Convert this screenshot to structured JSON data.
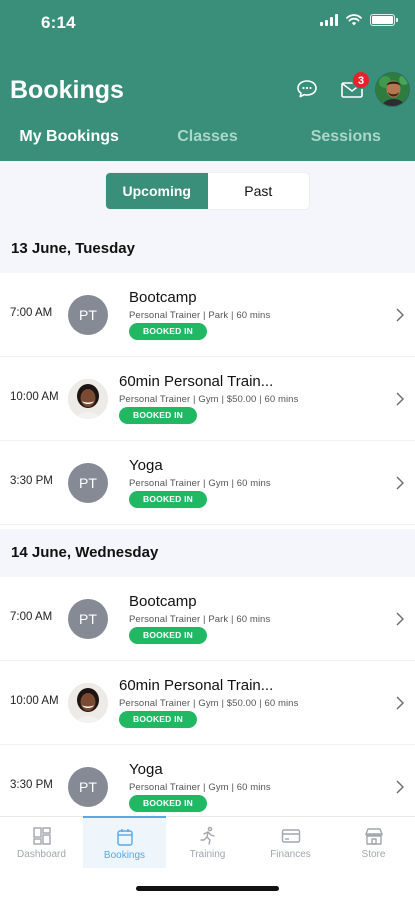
{
  "status_bar": {
    "time": "6:14"
  },
  "header": {
    "title": "Bookings",
    "mail_badge": "3",
    "tabs": [
      {
        "label": "My Bookings",
        "active": true
      },
      {
        "label": "Classes",
        "active": false
      },
      {
        "label": "Sessions",
        "active": false
      }
    ]
  },
  "segmented": {
    "upcoming": "Upcoming",
    "past": "Past",
    "selected": "Upcoming"
  },
  "sections": [
    {
      "date": "13 June, Tuesday",
      "items": [
        {
          "time": "7:00 AM",
          "avatar": "PT",
          "title": "Bootcamp",
          "subtitle": "Personal Trainer | Park | 60 mins",
          "status": "BOOKED IN"
        },
        {
          "time": "10:00 AM",
          "avatar": "photo",
          "title": "60min Personal Train...",
          "subtitle": "Personal Trainer | Gym | $50.00 | 60 mins",
          "status": "BOOKED IN"
        },
        {
          "time": "3:30 PM",
          "avatar": "PT",
          "title": "Yoga",
          "subtitle": "Personal Trainer | Gym | 60 mins",
          "status": "BOOKED IN"
        }
      ]
    },
    {
      "date": "14 June, Wednesday",
      "items": [
        {
          "time": "7:00 AM",
          "avatar": "PT",
          "title": "Bootcamp",
          "subtitle": "Personal Trainer | Park | 60 mins",
          "status": "BOOKED IN"
        },
        {
          "time": "10:00 AM",
          "avatar": "photo",
          "title": "60min Personal Train...",
          "subtitle": "Personal Trainer | Gym | $50.00 | 60 mins",
          "status": "BOOKED IN"
        },
        {
          "time": "3:30 PM",
          "avatar": "PT",
          "title": "Yoga",
          "subtitle": "Personal Trainer | Gym | 60 mins",
          "status": "BOOKED IN"
        }
      ]
    }
  ],
  "bottom_nav": [
    {
      "label": "Dashboard",
      "icon": "dashboard-icon",
      "active": false
    },
    {
      "label": "Bookings",
      "icon": "calendar-icon",
      "active": true
    },
    {
      "label": "Training",
      "icon": "running-icon",
      "active": false
    },
    {
      "label": "Finances",
      "icon": "credit-card-icon",
      "active": false
    },
    {
      "label": "Store",
      "icon": "store-icon",
      "active": false
    }
  ],
  "colors": {
    "header": "#3a8f7a",
    "booked_badge": "#21b864",
    "nav_active": "#56a8e6",
    "notification": "#e8222b"
  }
}
